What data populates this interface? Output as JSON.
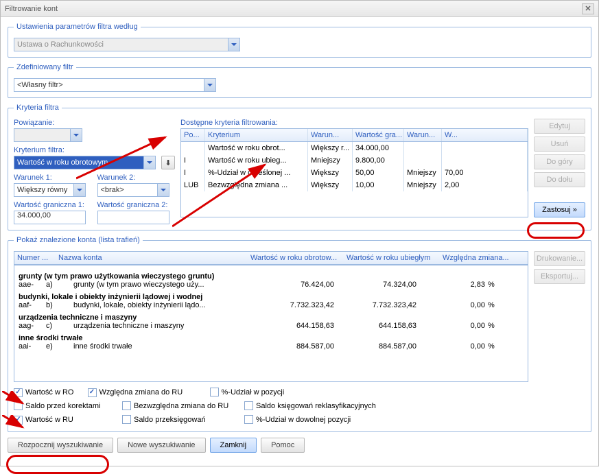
{
  "window": {
    "title": "Filtrowanie kont"
  },
  "groups": {
    "settings": "Ustawienia parametrów filtra według",
    "defined_filter": "Zdefiniowany filtr",
    "criteria": "Kryteria filtra",
    "results": "Pokaż znalezione konta (lista trafień)"
  },
  "settings": {
    "law_value": "Ustawa o Rachunkowości"
  },
  "defined_filter": {
    "value": "<Własny filtr>"
  },
  "criteria": {
    "labels": {
      "link": "Powiązanie:",
      "crit": "Kryterium filtra:",
      "cond1": "Warunek 1:",
      "cond2": "Warunek 2:",
      "limit1": "Wartość graniczna 1:",
      "limit2": "Wartość graniczna 2:",
      "available": "Dostępne kryteria filtrowania:"
    },
    "link_value": "",
    "crit_value": "Wartość w roku obrotowym",
    "cond1_value": "Większy równy",
    "cond2_value": "<brak>",
    "limit1_value": "34.000,00",
    "limit2_value": ""
  },
  "criteria_table": {
    "columns": [
      "Po...",
      "Kryterium",
      "Warun...",
      "Wartość gra...",
      "Warun...",
      "W..."
    ],
    "rows": [
      {
        "po": "",
        "krit": "Wartość w roku obrot...",
        "w1": "Większy r...",
        "v1": "34.000,00",
        "w2": "",
        "v2": ""
      },
      {
        "po": "I",
        "krit": "Wartość w roku ubieg...",
        "w1": "Mniejszy",
        "v1": "9.800,00",
        "w2": "",
        "v2": ""
      },
      {
        "po": "I",
        "krit": "%-Udział w określonej ...",
        "w1": "Większy",
        "v1": "50,00",
        "w2": "Mniejszy",
        "v2": "70,00"
      },
      {
        "po": "LUB",
        "krit": "Bezwzględna zmiana ...",
        "w1": "Większy",
        "v1": "10,00",
        "w2": "Mniejszy",
        "v2": "2,00"
      }
    ]
  },
  "side_buttons": {
    "edit": "Edytuj",
    "delete": "Usuń",
    "up": "Do góry",
    "down": "Do dołu",
    "apply": "Zastosuj »"
  },
  "results_table": {
    "columns": [
      "Numer ...",
      "Nazwa konta",
      "Wartość w roku obrotow...",
      "Wartość w roku ubiegłym",
      "Względna zmiana..."
    ]
  },
  "results": [
    {
      "group": "grunty (w tym prawo użytkowania wieczystego gruntu)",
      "id": "aae-",
      "sub": "a)",
      "name": "grunty (w tym prawo wieczystego uży...",
      "v1": "76.424,00",
      "v2": "74.324,00",
      "pct": "2,83"
    },
    {
      "group": "budynki, lokale i obiekty inżynierii lądowej i wodnej",
      "id": "aaf-",
      "sub": "b)",
      "name": "budynki, lokale, obiekty inżynierii lądo...",
      "v1": "7.732.323,42",
      "v2": "7.732.323,42",
      "pct": "0,00"
    },
    {
      "group": "urządzenia techniczne i maszyny",
      "id": "aag-",
      "sub": "c)",
      "name": "urządzenia techniczne i maszyny",
      "v1": "644.158,63",
      "v2": "644.158,63",
      "pct": "0,00"
    },
    {
      "group": "inne środki trwałe",
      "id": "aai-",
      "sub": "e)",
      "name": "inne środki trwałe",
      "v1": "884.587,00",
      "v2": "884.587,00",
      "pct": "0,00"
    }
  ],
  "checkboxes": {
    "r0": "Wartość w RO",
    "rel": "Względna zmiana do RU",
    "pct_pos": "%-Udział w pozycji",
    "before": "Saldo przed korektami",
    "abs": "Bezwzględna zmiana do RU",
    "reklas": "Saldo księgowań reklasyfikacyjnych",
    "ru": "Wartość w RU",
    "rebooked": "Saldo przeksięgowań",
    "pct_any": "%-Udział w dowolnej pozycji"
  },
  "side_buttons2": {
    "print": "Drukowanie...",
    "export": "Eksportuj..."
  },
  "bottom": {
    "search": "Rozpocznij wyszukiwanie",
    "new": "Nowe wyszukiwanie",
    "close": "Zamknij",
    "help": "Pomoc"
  }
}
